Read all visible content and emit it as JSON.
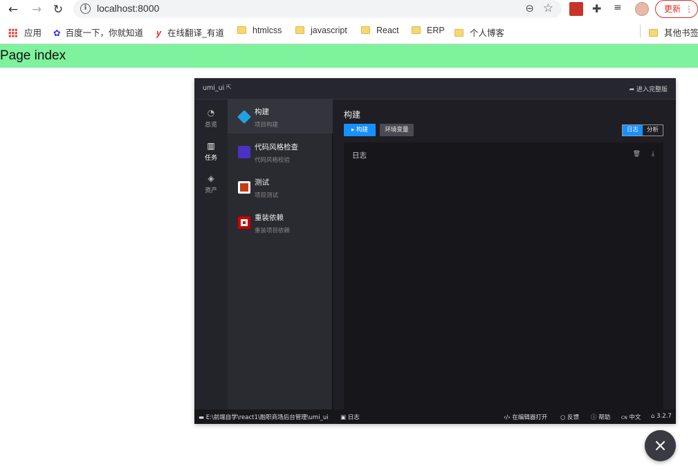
{
  "browser": {
    "url": "localhost:8000",
    "update_label": "更新",
    "bookmarks": [
      {
        "label": "应用",
        "icon": "apps-grid-icon"
      },
      {
        "label": "百度一下，你就知道",
        "icon": "baidu-paw-icon"
      },
      {
        "label": "在线翻译_有道",
        "icon": "youdao-y-icon"
      },
      {
        "label": "htmlcss",
        "icon": "folder-icon"
      },
      {
        "label": "javascript",
        "icon": "folder-icon"
      },
      {
        "label": "React",
        "icon": "folder-icon"
      },
      {
        "label": "ERP",
        "icon": "folder-icon"
      },
      {
        "label": "个人博客",
        "icon": "folder-icon"
      },
      {
        "label": "其他书签",
        "icon": "folder-icon"
      }
    ]
  },
  "page": {
    "title": "Page index"
  },
  "umi": {
    "project_name": "umi_ui",
    "full_version_link": "进入完整版",
    "nav": [
      {
        "label": "总览",
        "icon": "dashboard-icon"
      },
      {
        "label": "任务",
        "icon": "task-board-icon"
      },
      {
        "label": "资产",
        "icon": "layers-icon"
      }
    ],
    "tasks": [
      {
        "title": "构建",
        "subtitle": "项目构建",
        "icon": "cube-build-icon",
        "color": "#1fa2e0"
      },
      {
        "title": "代码风格检查",
        "subtitle": "代码风格校验",
        "icon": "eslint-icon",
        "color": "#4b32c3"
      },
      {
        "title": "测试",
        "subtitle": "项目测试",
        "icon": "jest-icon",
        "color": "#c63d14"
      },
      {
        "title": "重装依赖",
        "subtitle": "重装项目依赖",
        "icon": "npm-icon",
        "color": "#cb0000"
      }
    ],
    "main": {
      "title": "构建",
      "build_button": "构建",
      "env_button": "环境变量",
      "seg_log": "日志",
      "seg_analyze": "分析",
      "log_title": "日志"
    },
    "footer": {
      "path": "E:\\前端自学\\react1\\融职商场后台管理\\umi_ui",
      "log": "日志",
      "open_editor": "在编辑器打开",
      "feedback": "反馈",
      "help": "帮助",
      "lang_code": "CN",
      "lang": "中文",
      "version": "3.2.7"
    }
  },
  "close_symbol": "×"
}
